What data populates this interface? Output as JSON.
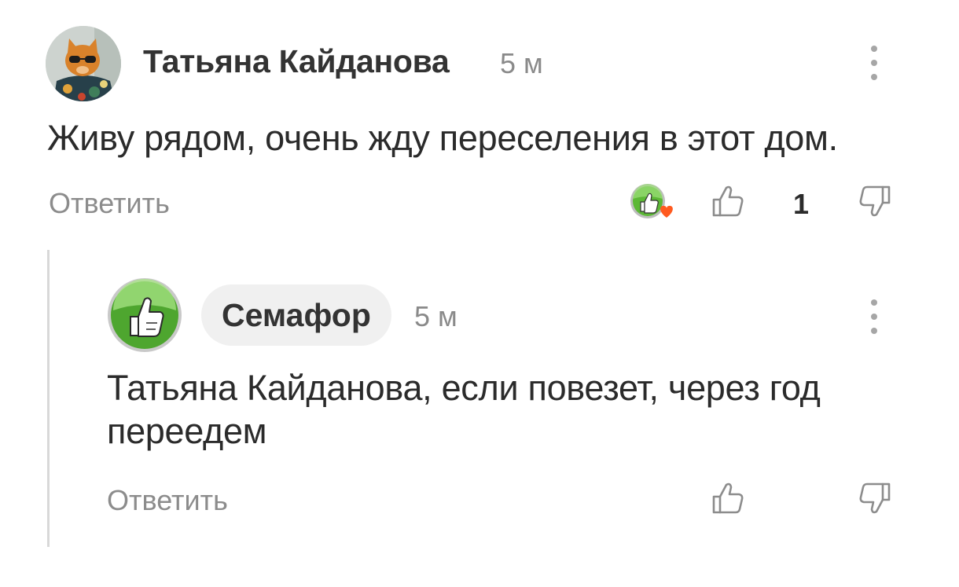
{
  "comments": [
    {
      "author": "Татьяна Кайданова",
      "time": "5 м",
      "text": "Живу рядом, очень жду переселения в этот дом.",
      "reply_label": "Ответить",
      "likes": "1",
      "avatar_icon": "cat-with-sunglasses-avatar",
      "reaction_icon": "thumbs-up-heart-badge-icon"
    },
    {
      "author": "Семафор",
      "time": "5 м",
      "text": "Татьяна Кайданова, если повезет, через год переедем",
      "reply_label": "Ответить",
      "avatar_icon": "green-thumbs-up-avatar"
    }
  ],
  "colors": {
    "accent_green": "#4caf2a",
    "heart": "#ff5a1f",
    "muted": "#8c8c8c"
  }
}
